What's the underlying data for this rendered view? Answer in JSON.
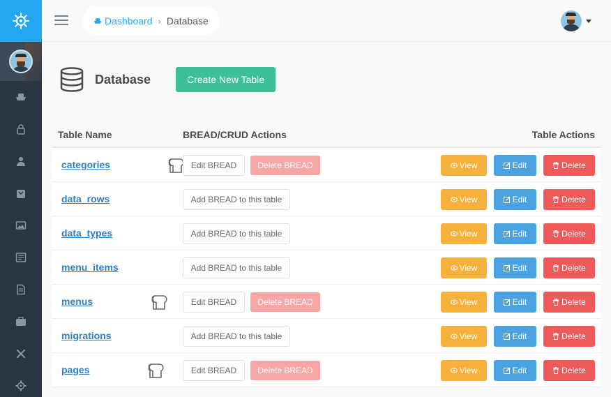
{
  "breadcrumb": {
    "home": "Dashboard",
    "separator": "›",
    "current": "Database"
  },
  "page": {
    "title": "Database",
    "create_button": "Create New Table"
  },
  "table": {
    "headers": {
      "name": "Table Name",
      "bread": "BREAD/CRUD Actions",
      "actions": "Table Actions"
    },
    "labels": {
      "edit_bread": "Edit BREAD",
      "delete_bread": "Delete BREAD",
      "add_bread": "Add BREAD to this table",
      "view": "View",
      "edit": "Edit",
      "delete": "Delete"
    },
    "rows": [
      {
        "name": "categories",
        "has_bread": true
      },
      {
        "name": "data_rows",
        "has_bread": false
      },
      {
        "name": "data_types",
        "has_bread": false
      },
      {
        "name": "menu_items",
        "has_bread": false
      },
      {
        "name": "menus",
        "has_bread": true
      },
      {
        "name": "migrations",
        "has_bread": false
      },
      {
        "name": "pages",
        "has_bread": true
      }
    ]
  },
  "icons": {
    "logo": "helm-icon",
    "sidebar": [
      "boat-icon",
      "lock-icon",
      "user-icon",
      "bag-icon",
      "image-icon",
      "news-icon",
      "file-icon",
      "briefcase-icon",
      "tools-icon",
      "gear-icon"
    ]
  },
  "colors": {
    "sidebar": "#2a3542",
    "logo_bg": "#22a7f0",
    "create": "#3dbf98",
    "view": "#f6b13d",
    "edit": "#4aa3e0",
    "delete": "#ee5a5a",
    "delete_bread": "#f8a5a5"
  }
}
